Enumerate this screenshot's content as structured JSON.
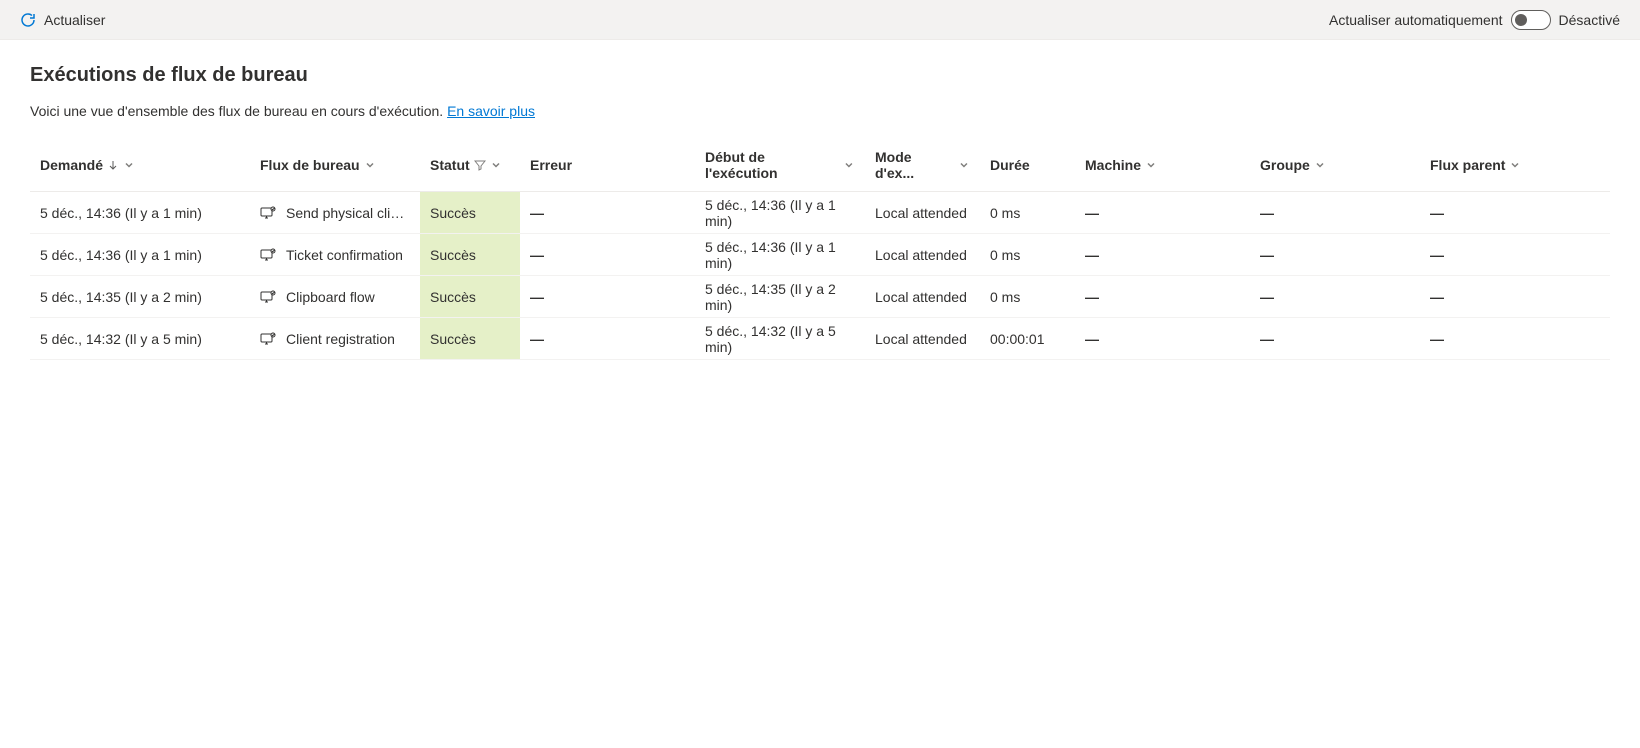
{
  "toolbar": {
    "refresh_label": "Actualiser",
    "auto_refresh_label": "Actualiser automatiquement",
    "toggle_state": "Désactivé"
  },
  "page": {
    "title": "Exécutions de flux de bureau",
    "subtitle_text": "Voici une vue d'ensemble des flux de bureau en cours d'exécution. ",
    "learn_more": "En savoir plus"
  },
  "columns": {
    "requested": "Demandé",
    "flow": "Flux de bureau",
    "status": "Statut",
    "error": "Erreur",
    "start": "Début de l'exécution",
    "mode": "Mode d'ex...",
    "duration": "Durée",
    "machine": "Machine",
    "group": "Groupe",
    "parent": "Flux parent"
  },
  "rows": [
    {
      "requested": "5 déc., 14:36 (Il y a 1 min)",
      "flow": "Send physical click o...",
      "status": "Succès",
      "error": "—",
      "start": "5 déc., 14:36 (Il y a 1 min)",
      "mode": "Local attended",
      "duration": "0 ms",
      "machine": "—",
      "group": "—",
      "parent": "—"
    },
    {
      "requested": "5 déc., 14:36 (Il y a 1 min)",
      "flow": "Ticket confirmation",
      "status": "Succès",
      "error": "—",
      "start": "5 déc., 14:36 (Il y a 1 min)",
      "mode": "Local attended",
      "duration": "0 ms",
      "machine": "—",
      "group": "—",
      "parent": "—"
    },
    {
      "requested": "5 déc., 14:35 (Il y a 2 min)",
      "flow": "Clipboard flow",
      "status": "Succès",
      "error": "—",
      "start": "5 déc., 14:35 (Il y a 2 min)",
      "mode": "Local attended",
      "duration": "0 ms",
      "machine": "—",
      "group": "—",
      "parent": "—"
    },
    {
      "requested": "5 déc., 14:32 (Il y a 5 min)",
      "flow": "Client registration",
      "status": "Succès",
      "error": "—",
      "start": "5 déc., 14:32 (Il y a 5 min)",
      "mode": "Local attended",
      "duration": "00:00:01",
      "machine": "—",
      "group": "—",
      "parent": "—"
    }
  ]
}
